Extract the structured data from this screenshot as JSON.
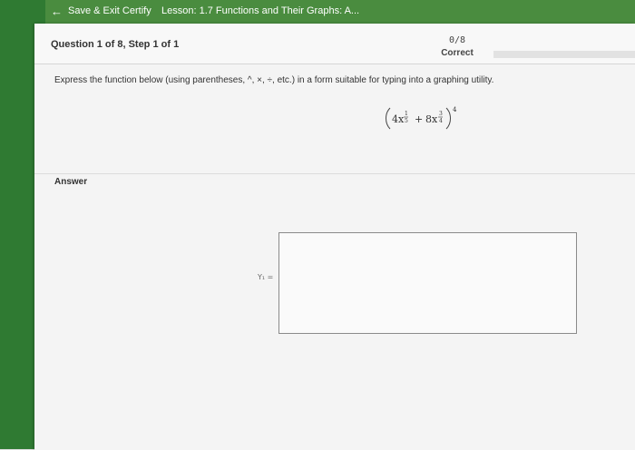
{
  "nav": {
    "back_label": "Save & Exit Certify",
    "lesson_title": "Lesson: 1.7 Functions and Their Graphs: A..."
  },
  "question": {
    "title": "Question 1 of 8, Step 1 of 1",
    "score": "0/8",
    "score_status": "Correct",
    "prompt": "Express the function below (using parentheses, ^, ×, ÷, etc.) in a form suitable for typing into a graphing utility."
  },
  "answer": {
    "label": "Answer",
    "input_prefix": "Y₁ =",
    "value": ""
  },
  "icons": [
    "back-arrow-icon"
  ]
}
